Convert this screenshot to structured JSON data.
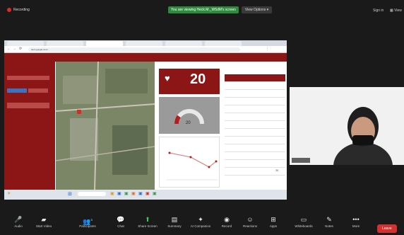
{
  "zoom": {
    "recording_label": "Recording",
    "share_banner": "You are viewing Heck.M._W5dM's screen",
    "view_options": "View Options",
    "sign_in": "Sign in",
    "view": "View",
    "colors": {
      "recording": "#e02828",
      "share_banner": "#2d8c3c",
      "end": "#d3302f"
    }
  },
  "browser": {
    "tabs": [
      "",
      "",
      "",
      "",
      "",
      "",
      ""
    ],
    "url": "docs.google.com/..."
  },
  "dashboard": {
    "header_title": "",
    "filters_title": "",
    "kpi_title": "",
    "kpi_value": "20",
    "gauge_value": "20",
    "gauge_fraction": 0.2,
    "map_label": "",
    "table_title": "",
    "table_headers": [
      "",
      ""
    ],
    "table_rows": [
      [
        "",
        ""
      ],
      [
        "",
        ""
      ],
      [
        "",
        ""
      ],
      [
        "",
        ""
      ],
      [
        "",
        ""
      ],
      [
        "",
        ""
      ],
      [
        "",
        ""
      ],
      [
        "",
        ""
      ],
      [
        "",
        ""
      ],
      [
        "",
        ""
      ],
      [
        "",
        ""
      ]
    ],
    "table_total": [
      "",
      "20"
    ],
    "chart_title": "",
    "colors": {
      "header": "#8c1515",
      "accent": "#b31d1d"
    }
  },
  "participant": {
    "name_tag": ""
  },
  "toolbar": {
    "audio": "Audio",
    "video": "Start Video",
    "participants": "Participants",
    "participants_count": "3",
    "chat": "Chat",
    "share": "Share Screen",
    "summary": "Summary",
    "companion": "AI Companion",
    "record": "Record",
    "reactions": "Reactions",
    "apps": "Apps",
    "whiteboards": "Whiteboards",
    "notes": "Notes",
    "more": "More",
    "end": "Leave"
  }
}
